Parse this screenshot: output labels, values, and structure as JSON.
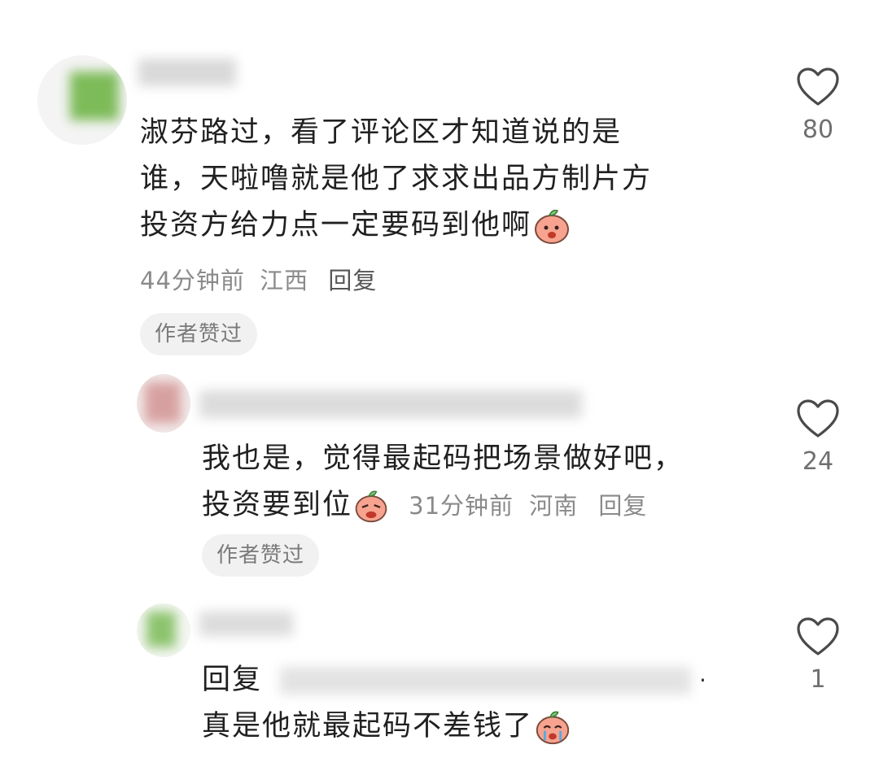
{
  "comments": [
    {
      "username": "",
      "text_lines": [
        "淑芬路过，看了评论区才知道说的是",
        "谁，天啦噜就是他了求求出品方制片方",
        "投资方给力点一定要码到他啊"
      ],
      "time": "44分钟前",
      "location": "江西",
      "reply_label": "回复",
      "author_badge": "作者赞过",
      "like_count": "80"
    },
    {
      "username": "",
      "text_lines": [
        "我也是，觉得最起码把场景做好吧，",
        "投资要到位"
      ],
      "time": "31分钟前",
      "location": "河南",
      "reply_label": "回复",
      "author_badge": "作者赞过",
      "like_count": "24"
    },
    {
      "username": "",
      "reply_prefix": "回复",
      "reply_to": "",
      "text_line2": "真是他就最起码不差钱了",
      "like_count": "1"
    }
  ],
  "colors": {
    "text": "#202020",
    "meta": "#8a8a8a",
    "badge_bg": "#f1f1f1",
    "heart": "#4a4a4a",
    "emoji_face": "#f7a38f",
    "emoji_leaf": "#7cc576"
  },
  "icons": [
    "heart-outline-icon",
    "peach-sticker-icon"
  ]
}
